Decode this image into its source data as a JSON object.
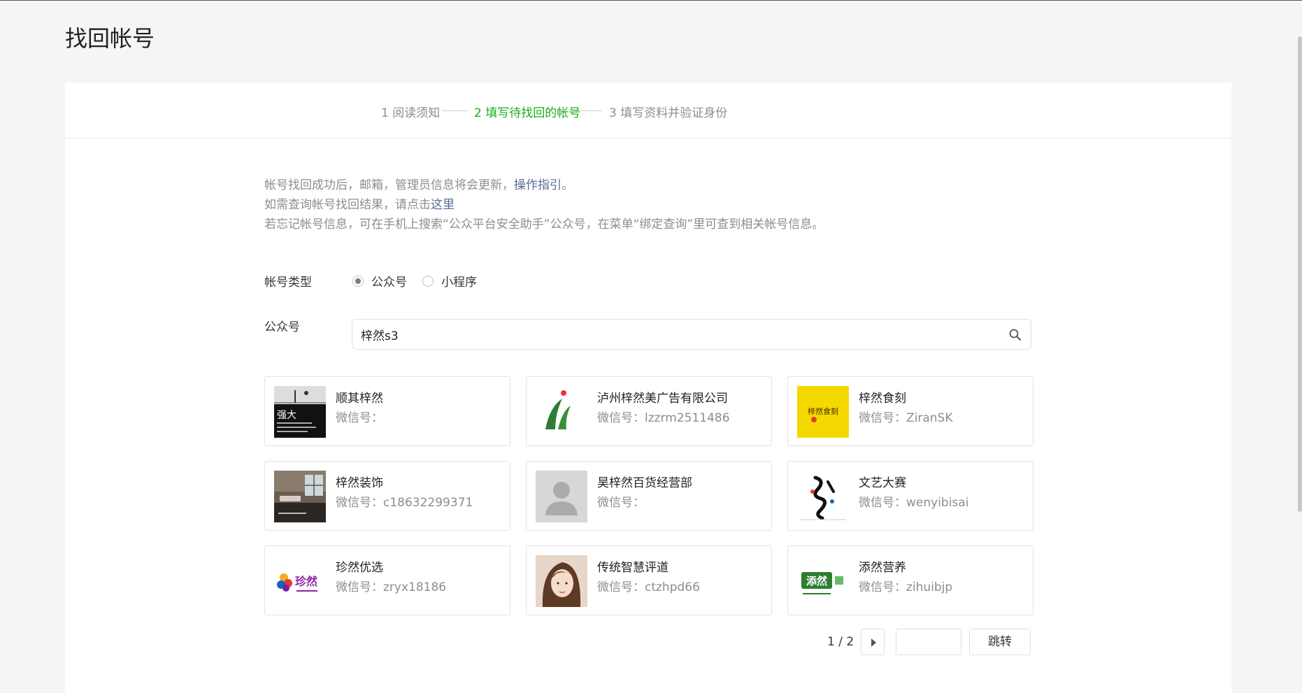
{
  "page": {
    "title": "找回帐号"
  },
  "steps": [
    {
      "label": "1 阅读须知",
      "active": false
    },
    {
      "label": "2 填写待找回的帐号",
      "active": true
    },
    {
      "label": "3 填写资料并验证身份",
      "active": false
    }
  ],
  "notes": {
    "line1_text": "帐号找回成功后，邮箱，管理员信息将会更新，",
    "line1_link": "操作指引",
    "line1_tail": "。",
    "line2_text": "如需查询帐号找回结果，请点击",
    "line2_link": "这里",
    "line3_text": "若忘记帐号信息，可在手机上搜索“公众平台安全助手”公众号，在菜单“绑定查询”里可查到相关帐号信息。"
  },
  "form": {
    "type_label": "帐号类型",
    "type_options": [
      {
        "label": "公众号",
        "checked": true
      },
      {
        "label": "小程序",
        "checked": false
      }
    ],
    "account_label": "公众号",
    "search_value": "梓然s3",
    "search_icon": "search-icon"
  },
  "results": [
    {
      "name": "顺其梓然",
      "id_label": "微信号："
    },
    {
      "name": "泸州梓然美广告有限公司",
      "id_label": "微信号：lzzrm2511486"
    },
    {
      "name": "梓然食刻",
      "id_label": "微信号：ZiranSK"
    },
    {
      "name": "梓然装饰",
      "id_label": "微信号：c18632299371"
    },
    {
      "name": "昊梓然百货经营部",
      "id_label": "微信号："
    },
    {
      "name": "文艺大赛",
      "id_label": "微信号：wenyibisai"
    },
    {
      "name": "珍然优选",
      "id_label": "微信号：zryx18186"
    },
    {
      "name": "传统智慧评道",
      "id_label": "微信号：ctzhpd66"
    },
    {
      "name": "添然营养",
      "id_label": "微信号：zihuibjp"
    }
  ],
  "avatar_text": {
    "r0_big": "强大",
    "r2_logo": "梓然食刻",
    "r6_logo": "珍然",
    "r8_logo": "添然"
  },
  "pager": {
    "info": "1 / 2",
    "jump_label": "跳转",
    "input_value": ""
  },
  "colors": {
    "accent": "#1aad19",
    "link": "#576b95",
    "muted": "#8d8d8d"
  }
}
